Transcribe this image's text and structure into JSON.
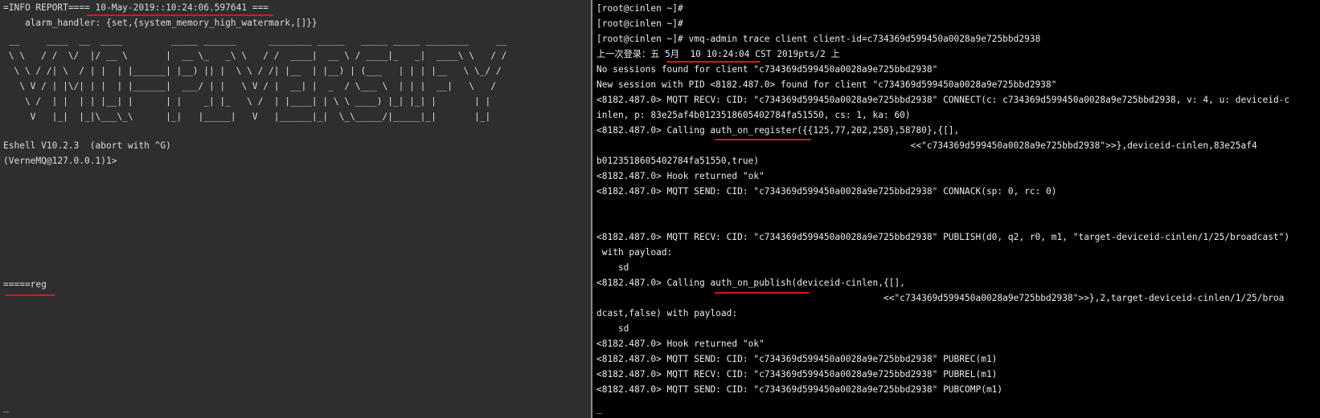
{
  "left": {
    "lines": [
      "=INFO REPORT==== 10-May-2019::10:24:06.597641 ===",
      "    alarm_handler: {set,{system_memory_high_watermark,[]}}"
    ],
    "banner": [
      " __     ____  __  ____         _____ ______      ________ _____   _____ _____ ________     __",
      " \\ \\   / /  \\/  |/ __ \\       |  __ \\_   _\\ \\   / /  ____|  __ \\ / ____|_   _|  ____\\ \\   / /",
      "  \\ \\ / /| \\  / | |  | |______| |__) || |  \\ \\ / /| |__  | |__) | (___   | | | |__   \\ \\_/ /",
      "   \\ V / | |\\/| | |  | |______|  ___/ | |   \\ V / |  __| |  _  / \\___ \\  | | |  __|   \\   /",
      "    \\ /  | |  | | |__| |      | |    _| |_   \\ /  | |____| | \\ \\ ____) |_| |_| |       | |",
      "     V   |_|  |_|\\___\\_\\      |_|   |_____|   V   |______|_|  \\_\\_____/|_____|_|       |_|"
    ],
    "shell_version": "Eshell V10.2.3  (abort with ^G)",
    "prompt": "(VerneMQ@127.0.0.1)1>",
    "reg_line": "=====reg",
    "cursor": "_"
  },
  "right": {
    "lines": [
      "[root@cinlen ~]#",
      "[root@cinlen ~]#",
      "[root@cinlen ~]# vmq-admin trace client client-id=c734369d599450a0028a9e725bbd2938",
      "上一次登录：五 5月  10 10:24:04 CST 2019pts/2 上",
      "No sessions found for client \"c734369d599450a0028a9e725bbd2938\"",
      "New session with PID <8182.487.0> found for client \"c734369d599450a0028a9e725bbd2938\"",
      "<8182.487.0> MQTT RECV: CID: \"c734369d599450a0028a9e725bbd2938\" CONNECT(c: c734369d599450a0028a9e725bbd2938, v: 4, u: deviceid-c",
      "inlen, p: 83e25af4b0123518605402784fa51550, cs: 1, ka: 60)",
      "<8182.487.0> Calling auth_on_register({{125,77,202,250},58780},{[],",
      "                                                          <<\"c734369d599450a0028a9e725bbd2938\">>},deviceid-cinlen,83e25af4",
      "b0123518605402784fa51550,true)",
      "<8182.487.0> Hook returned \"ok\"",
      "<8182.487.0> MQTT SEND: CID: \"c734369d599450a0028a9e725bbd2938\" CONNACK(sp: 0, rc: 0)",
      "",
      "",
      "<8182.487.0> MQTT RECV: CID: \"c734369d599450a0028a9e725bbd2938\" PUBLISH(d0, q2, r0, m1, \"target-deviceid-cinlen/1/25/broadcast\")",
      " with payload:",
      "    sd",
      "<8182.487.0> Calling auth_on_publish(deviceid-cinlen,{[],",
      "                                                     <<\"c734369d599450a0028a9e725bbd2938\">>},2,target-deviceid-cinlen/1/25/broa",
      "dcast,false) with payload:",
      "    sd",
      "<8182.487.0> Hook returned \"ok\"",
      "<8182.487.0> MQTT SEND: CID: \"c734369d599450a0028a9e725bbd2938\" PUBREC(m1)",
      "<8182.487.0> MQTT RECV: CID: \"c734369d599450a0028a9e725bbd2938\" PUBREL(m1)",
      "<8182.487.0> MQTT SEND: CID: \"c734369d599450a0028a9e725bbd2938\" PUBCOMP(m1)"
    ],
    "cursor": "_"
  },
  "colors": {
    "left_bg": "#2e2e2e",
    "right_bg": "#000000",
    "text": "#dcdcdc",
    "underline": "#e0131a"
  }
}
